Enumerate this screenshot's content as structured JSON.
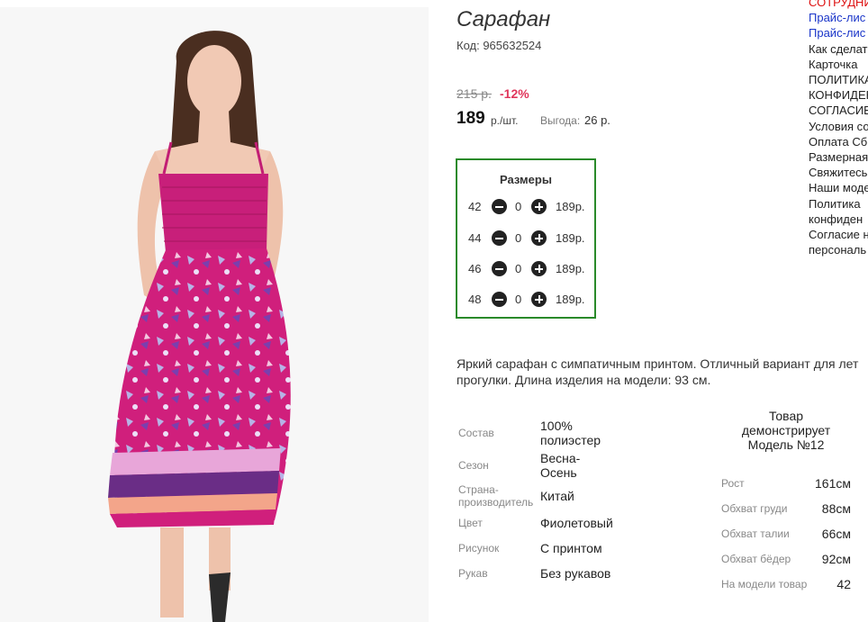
{
  "product": {
    "title": "Сарафан",
    "code": "Код: 965632524",
    "old_price": "215 р.",
    "discount": "-12%",
    "price": "189",
    "price_unit": "р./шт.",
    "benefit_label": "Выгода:",
    "benefit_value": "26 р."
  },
  "sizes": {
    "title": "Размеры",
    "rows": [
      {
        "size": "42",
        "qty": "0",
        "price": "189р."
      },
      {
        "size": "44",
        "qty": "0",
        "price": "189р."
      },
      {
        "size": "46",
        "qty": "0",
        "price": "189р."
      },
      {
        "size": "48",
        "qty": "0",
        "price": "189р."
      }
    ]
  },
  "sidebar": {
    "items": [
      "СОТРУДНИ",
      "Прайс-лис",
      "Прайс-лис",
      "Как сделат",
      "Карточка",
      "ПОЛИТИКА",
      "КОНФИДЕН",
      "СОГЛАСИЕ",
      "Условия со",
      "Оплата Сб",
      "Размерная",
      "Свяжитесь",
      "Наши моде",
      "Политика",
      "конфиден",
      "Согласие н",
      "персональ"
    ],
    "colors": {
      "red": "#dd1111",
      "blue": "#1a35c9"
    }
  },
  "description": {
    "line1": "Яркий сарафан с симпатичным принтом. Отличный вариант для лет",
    "line2": "прогулки. Длина изделия на модели: 93 см."
  },
  "attributes": [
    {
      "label": "Состав",
      "value_lines": [
        "100%",
        "полиэстер"
      ]
    },
    {
      "label": "Сезон",
      "value_lines": [
        "Весна-",
        "Осень"
      ]
    },
    {
      "label_lines": [
        "Страна-",
        "производитель"
      ],
      "value": "Китай"
    },
    {
      "label": "Цвет",
      "value": "Фиолетовый"
    },
    {
      "label": "Рисунок",
      "value": "С принтом"
    },
    {
      "label": "Рукав",
      "value": "Без рукавов"
    }
  ],
  "model": {
    "title_lines": [
      "Товар",
      "демонстрирует",
      "Модель №12"
    ],
    "params": [
      {
        "label": "Рост",
        "value": "161см"
      },
      {
        "label": "Обхват груди",
        "value": "88см"
      },
      {
        "label": "Обхват талии",
        "value": "66см"
      },
      {
        "label": "Обхват бёдер",
        "value": "92см"
      },
      {
        "label": "На модели товар",
        "value": "42"
      }
    ]
  },
  "colors": {
    "discount": "#e0365b",
    "sizes_border": "#2a8a2a",
    "dress": "#d4217f"
  }
}
